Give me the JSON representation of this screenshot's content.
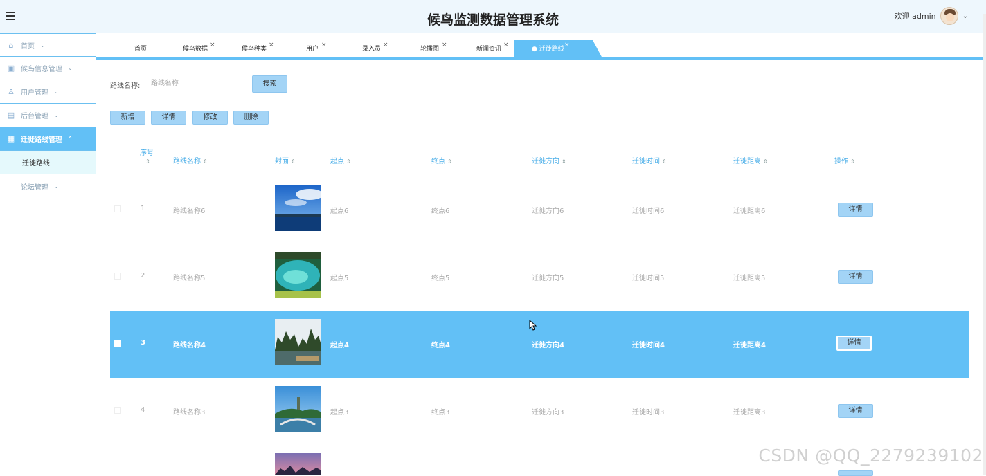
{
  "header": {
    "title": "候鸟监测数据管理系统",
    "welcome": "欢迎 admin",
    "user_chevron": "⌄"
  },
  "sidebar": {
    "items": [
      {
        "label": "首页",
        "icon": "home-icon"
      },
      {
        "label": "候鸟信息管理",
        "icon": "record-icon"
      },
      {
        "label": "用户管理",
        "icon": "user-icon"
      },
      {
        "label": "后台管理",
        "icon": "book-icon"
      },
      {
        "label": "迁徙路线管理",
        "icon": "grid-icon"
      },
      {
        "label": "论坛管理",
        "icon": "forum-icon"
      }
    ],
    "sub_item": "迁徙路线"
  },
  "tabs": [
    {
      "label": "首页"
    },
    {
      "label": "候鸟数据"
    },
    {
      "label": "候鸟种类"
    },
    {
      "label": "用户"
    },
    {
      "label": "录入员"
    },
    {
      "label": "轮播图"
    },
    {
      "label": "新闻资讯"
    },
    {
      "label": "● 迁徙路线",
      "active": true
    }
  ],
  "search": {
    "label": "路线名称:",
    "placeholder": "路线名称",
    "button": "搜索"
  },
  "actions": {
    "add": "新增",
    "detail": "详情",
    "edit": "修改",
    "delete": "删除"
  },
  "table": {
    "headers": [
      "序号",
      "路线名称",
      "封面",
      "起点",
      "终点",
      "迁徙方向",
      "迁徙时间",
      "迁徙距离",
      "操作"
    ],
    "rows": [
      {
        "index": "1",
        "name": "路线名称6",
        "start": "起点6",
        "end": "终点6",
        "direction": "迁徙方向6",
        "time": "迁徙时间6",
        "distance": "迁徙距离6",
        "action": "详情",
        "image": "lake-sky"
      },
      {
        "index": "2",
        "name": "路线名称5",
        "start": "起点5",
        "end": "终点5",
        "direction": "迁徙方向5",
        "time": "迁徙时间5",
        "distance": "迁徙距离5",
        "action": "详情",
        "image": "blue-pool"
      },
      {
        "index": "3",
        "name": "路线名称4",
        "start": "起点4",
        "end": "终点4",
        "direction": "迁徙方向4",
        "time": "迁徙时间4",
        "distance": "迁徙距离4",
        "action": "详情",
        "image": "karst-river",
        "selected": true
      },
      {
        "index": "4",
        "name": "路线名称3",
        "start": "起点3",
        "end": "终点3",
        "direction": "迁徙方向3",
        "time": "迁徙时间3",
        "distance": "迁徙距离3",
        "action": "详情",
        "image": "arch-bridge"
      }
    ]
  },
  "watermark": "CSDN @QQ_2279239102"
}
